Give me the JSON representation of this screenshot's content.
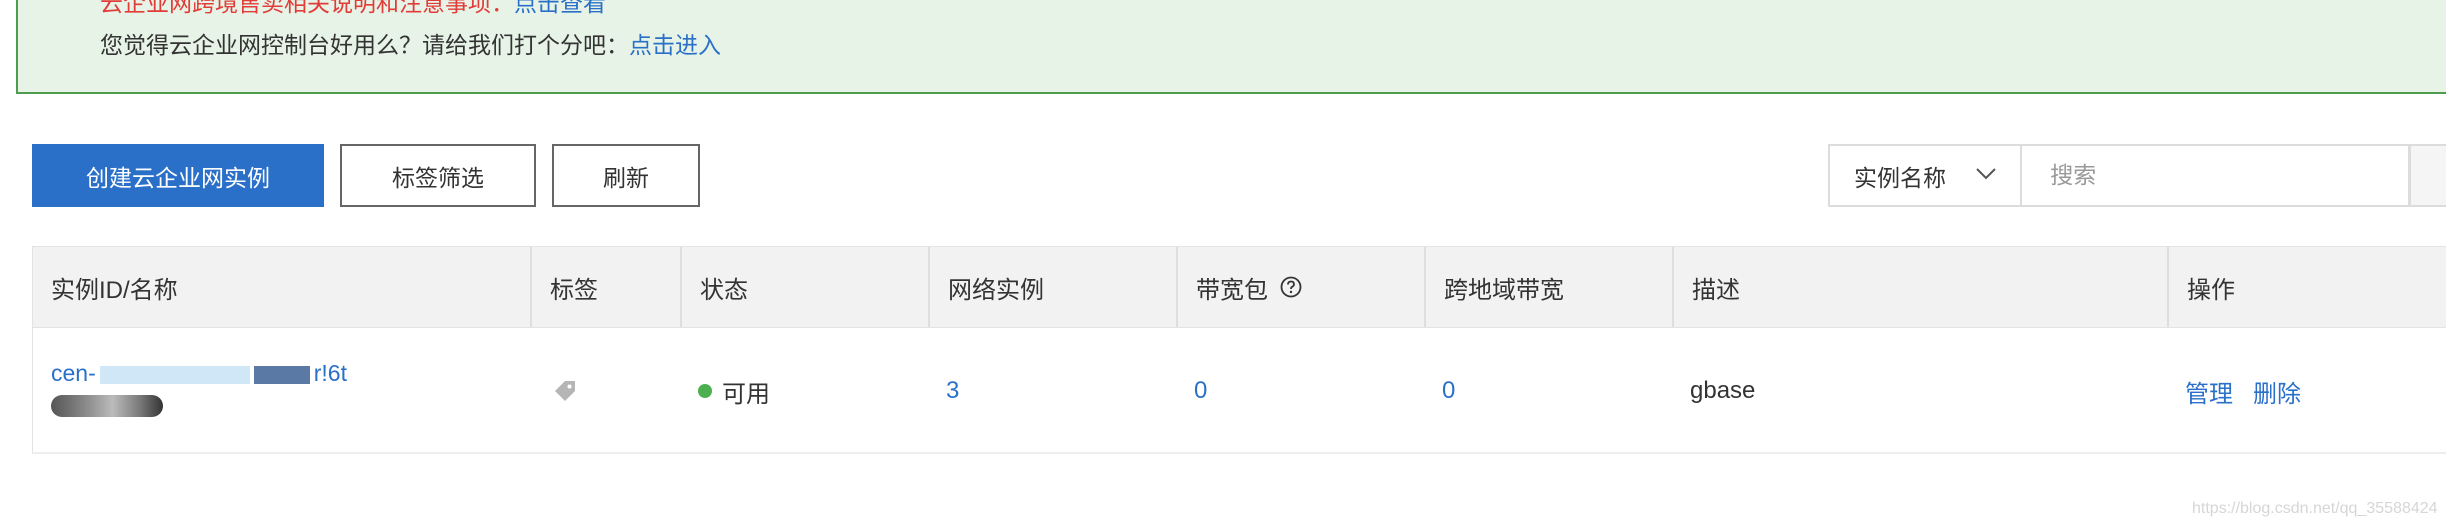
{
  "notice": {
    "line1_text": "云企业网跨境售卖相关说明和注意事项：",
    "line1_link": "点击查看",
    "line2_text": "您觉得云企业网控制台好用么？请给我们打个分吧：",
    "line2_link": "点击进入"
  },
  "toolbar": {
    "create_label": "创建云企业网实例",
    "tag_filter_label": "标签筛选",
    "refresh_label": "刷新"
  },
  "search": {
    "type_selected": "实例名称",
    "placeholder": "搜索"
  },
  "table": {
    "columns": {
      "id_name": "实例ID/名称",
      "tags": "标签",
      "status": "状态",
      "network": "网络实例",
      "bandwidth": "带宽包",
      "cross_region": "跨地域带宽",
      "description": "描述",
      "actions": "操作"
    },
    "rows": [
      {
        "id_prefix": "cen-",
        "id_suffix": "r!6t",
        "status": "可用",
        "network_count": "3",
        "bandwidth_count": "0",
        "cross_region_count": "0",
        "description": "gbase",
        "action_manage": "管理",
        "action_delete": "删除"
      }
    ]
  },
  "watermark": "https://blog.csdn.net/qq_35588424",
  "colors": {
    "primary": "#2a70c9",
    "notice_bg": "#e6f3e6",
    "notice_border": "#4f9c4f",
    "warning_text": "#e23c39",
    "status_ok": "#4caf50"
  }
}
